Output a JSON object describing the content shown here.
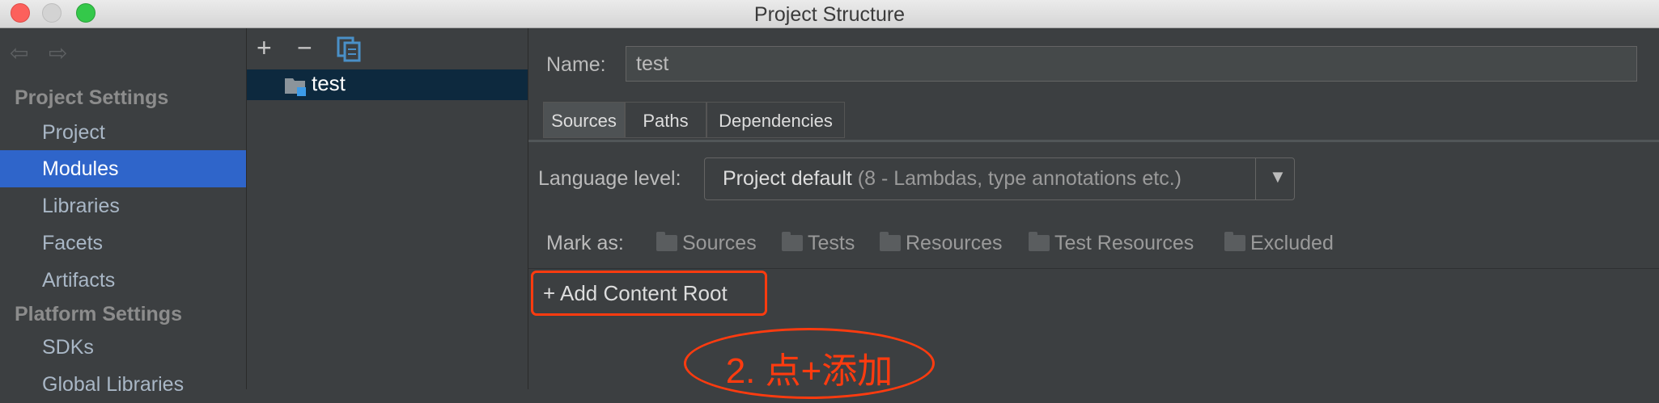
{
  "window": {
    "title": "Project Structure"
  },
  "sidebar": {
    "section_project": "Project Settings",
    "section_platform": "Platform Settings",
    "items": [
      {
        "label": "Project"
      },
      {
        "label": "Modules"
      },
      {
        "label": "Libraries"
      },
      {
        "label": "Facets"
      },
      {
        "label": "Artifacts"
      },
      {
        "label": "SDKs"
      },
      {
        "label": "Global Libraries"
      }
    ]
  },
  "module_tree": {
    "toolbar": {
      "add": "+",
      "remove": "−"
    },
    "modules": [
      {
        "name": "test"
      }
    ]
  },
  "module": {
    "name_label": "Name:",
    "name_value": "test",
    "tabs": [
      {
        "label": "Sources"
      },
      {
        "label": "Paths"
      },
      {
        "label": "Dependencies"
      }
    ],
    "language_level_label": "Language level:",
    "language_level_value": "Project default",
    "language_level_detail": "(8 - Lambdas, type annotations etc.)",
    "mark_as_label": "Mark as:",
    "mark_as": [
      {
        "label": "Sources"
      },
      {
        "label": "Tests"
      },
      {
        "label": "Resources"
      },
      {
        "label": "Test Resources"
      },
      {
        "label": "Excluded"
      }
    ],
    "add_content_root": "+ Add Content Root"
  },
  "annotation": {
    "text": "2. 点+添加",
    "color": "#ff3b0f"
  },
  "colors": {
    "selection": "#2f65ca",
    "tree_selection": "#0d293e",
    "panel_bg": "#3c3f41"
  }
}
